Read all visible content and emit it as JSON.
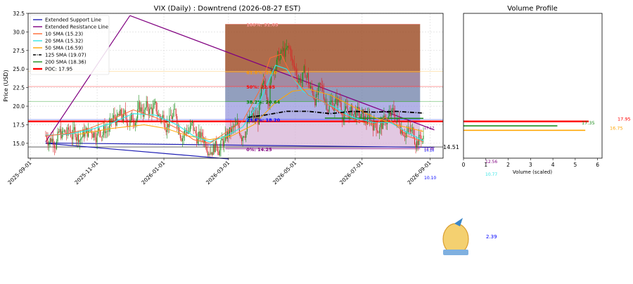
{
  "chart_data": [
    {
      "type": "candlestick",
      "title": "VIX (Daily) : Downtrend (2026-08-27 EST)",
      "ylabel": "Price (USD)",
      "xlabel": "",
      "ylim": [
        13.0,
        32.5
      ],
      "xlim": [
        "2025-08-30",
        "2026-09-13"
      ],
      "grid": true,
      "y_ticks": [
        "15.0",
        "17.5",
        "20.0",
        "22.5",
        "25.0",
        "27.5",
        "30.0",
        "32.5"
      ],
      "x_ticks": [
        "2025-09-01",
        "2025-11-01",
        "2026-01-01",
        "2026-03-01",
        "2026-05-01",
        "2026-07-01",
        "2026-09-01"
      ],
      "legend_position": "top-left",
      "legend": [
        {
          "label": "Extended Support Line",
          "color": "#1f1fb4",
          "style": "solid"
        },
        {
          "label": "Extended Resistance Line",
          "color": "#800080",
          "style": "solid"
        },
        {
          "label": "10 SMA (15.23)",
          "color": "#ff6a33",
          "style": "solid"
        },
        {
          "label": "20 SMA (15.32)",
          "color": "#33e5e5",
          "style": "solid"
        },
        {
          "label": "50 SMA (16.59)",
          "color": "#ffa500",
          "style": "solid"
        },
        {
          "label": "125 SMA (19.07)",
          "color": "#000000",
          "style": "dashdot"
        },
        {
          "label": "200 SMA (18.36)",
          "color": "#1a8c1a",
          "style": "solid"
        },
        {
          "label": "POC: 17.95",
          "color": "#ff0000",
          "style": "solid"
        }
      ],
      "fib_levels": [
        {
          "label": "100%: 31.05",
          "value": 31.05,
          "color": "#ff9999"
        },
        {
          "label": "61.8%: 24.6",
          "value": 24.6,
          "color": "#ff9900"
        },
        {
          "label": "50%: 22.65",
          "value": 22.65,
          "color": "#ff0000"
        },
        {
          "label": "38.2%: 20.64",
          "value": 20.64,
          "color": "#008000"
        },
        {
          "label": "23.6%: 18.20",
          "value": 18.2,
          "color": "#0000ff"
        },
        {
          "label": "0%: 14.25",
          "value": 14.25,
          "color": "#800080"
        }
      ],
      "fib_zone_dates": [
        "2026-02-26",
        "2026-08-23"
      ],
      "poc": 17.95,
      "horizontal_lines": [
        {
          "value": 24.7,
          "color": "#ffd27f"
        },
        {
          "value": 22.65,
          "color": "#ff6666"
        },
        {
          "value": 20.64,
          "color": "#66bb66"
        },
        {
          "value": 18.2,
          "color": "#6666ff"
        },
        {
          "value": 17.95,
          "color": "#ff0000"
        },
        {
          "value": 14.51,
          "color": "#000000"
        }
      ],
      "support_line": {
        "from": [
          "2025-09-15",
          15.05
        ],
        "to": [
          "2026-09-05",
          14.45
        ]
      },
      "support_line_2": {
        "from": [
          "2025-09-15",
          15.0
        ],
        "to": [
          "2026-03-01",
          12.9
        ]
      },
      "resistance_line": {
        "from": [
          "2025-09-15",
          15.2
        ],
        "to": [
          "2025-12-01",
          32.2
        ]
      },
      "resistance_line_2": {
        "from": [
          "2025-12-01",
          32.2
        ],
        "to": [
          "2026-09-05",
          16.8
        ]
      },
      "right_labels": [
        {
          "text": "14.51",
          "value": 14.51,
          "color": "#000000",
          "size": 8
        },
        {
          "text": "17.17",
          "value": 17.17,
          "color": "#800080",
          "size": 5
        },
        {
          "text": "14.36",
          "value": 14.36,
          "color": "#800080",
          "size": 5
        },
        {
          "text": "14.16",
          "value": 14.16,
          "color": "#0000ff",
          "size": 5
        }
      ],
      "below_labels": [
        {
          "text": "10.10",
          "color": "#0000ff"
        },
        {
          "text": "12.56",
          "color": "#800080"
        },
        {
          "text": "10.77",
          "color": "#33e5e5"
        },
        {
          "text": "2.39",
          "color": "#0000ff"
        }
      ],
      "sma10": [
        [
          0,
          16.0
        ],
        [
          20,
          16.3
        ],
        [
          40,
          17.0
        ],
        [
          60,
          18.2
        ],
        [
          80,
          19.5
        ],
        [
          100,
          18.5
        ],
        [
          120,
          17.0
        ],
        [
          135,
          15.5
        ],
        [
          150,
          15.0
        ],
        [
          165,
          16.5
        ],
        [
          180,
          18.0
        ],
        [
          195,
          22.0
        ],
        [
          205,
          26.5
        ],
        [
          215,
          27.0
        ],
        [
          225,
          24.0
        ],
        [
          240,
          21.5
        ],
        [
          255,
          20.5
        ],
        [
          270,
          19.0
        ],
        [
          285,
          18.0
        ],
        [
          300,
          17.5
        ],
        [
          310,
          18.5
        ],
        [
          320,
          17.5
        ],
        [
          330,
          16.0
        ],
        [
          345,
          15.2
        ]
      ],
      "sma20": [
        [
          0,
          16.1
        ],
        [
          20,
          16.2
        ],
        [
          40,
          16.8
        ],
        [
          60,
          17.7
        ],
        [
          80,
          19.0
        ],
        [
          100,
          18.8
        ],
        [
          120,
          17.5
        ],
        [
          135,
          16.0
        ],
        [
          150,
          15.2
        ],
        [
          165,
          16.0
        ],
        [
          180,
          17.2
        ],
        [
          195,
          20.5
        ],
        [
          210,
          25.5
        ],
        [
          220,
          25.0
        ],
        [
          235,
          22.0
        ],
        [
          250,
          20.8
        ],
        [
          265,
          19.8
        ],
        [
          280,
          18.5
        ],
        [
          300,
          17.8
        ],
        [
          315,
          17.8
        ],
        [
          330,
          16.5
        ],
        [
          345,
          15.3
        ]
      ],
      "sma50": [
        [
          30,
          16.2
        ],
        [
          60,
          17.0
        ],
        [
          90,
          17.5
        ],
        [
          110,
          17.0
        ],
        [
          130,
          16.0
        ],
        [
          150,
          15.5
        ],
        [
          170,
          16.0
        ],
        [
          190,
          17.5
        ],
        [
          210,
          20.5
        ],
        [
          225,
          22.0
        ],
        [
          240,
          22.3
        ],
        [
          260,
          21.5
        ],
        [
          280,
          20.0
        ],
        [
          300,
          18.5
        ],
        [
          320,
          17.5
        ],
        [
          345,
          16.6
        ]
      ],
      "sma125": [
        [
          185,
          18.5
        ],
        [
          200,
          18.8
        ],
        [
          220,
          19.3
        ],
        [
          240,
          19.3
        ],
        [
          260,
          19.0
        ],
        [
          280,
          19.3
        ],
        [
          300,
          19.2
        ],
        [
          320,
          19.3
        ],
        [
          345,
          19.07
        ]
      ],
      "sma200": [
        [
          255,
          18.4
        ],
        [
          345,
          18.36
        ]
      ]
    },
    {
      "type": "bar",
      "orientation": "horizontal",
      "title": "Volume Profile",
      "xlabel": "Volume (scaled)",
      "xlim": [
        0,
        6.2
      ],
      "ylim": [
        13.0,
        32.5
      ],
      "x_ticks": [
        "0",
        "1",
        "2",
        "3",
        "4",
        "5",
        "6"
      ],
      "bars": [
        {
          "price": 17.95,
          "value": 5.6,
          "color": "#ff0000",
          "label": "17.95"
        },
        {
          "price": 17.35,
          "value": 4.2,
          "color": "#1a8c1a",
          "label": "17.35"
        },
        {
          "price": 16.75,
          "value": 5.45,
          "color": "#ffa500",
          "label": "16.75"
        }
      ]
    }
  ]
}
